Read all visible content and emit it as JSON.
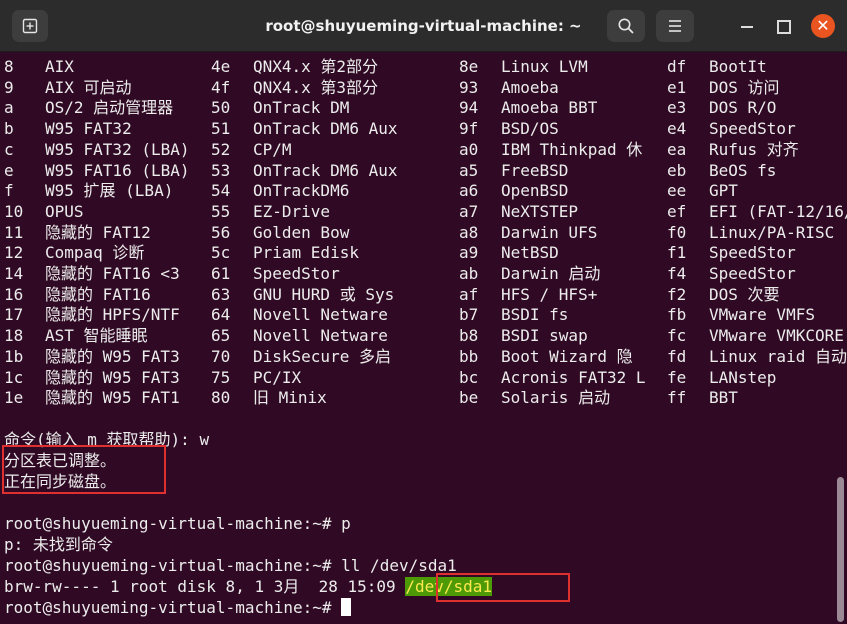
{
  "window": {
    "title": "root@shuyueming-virtual-machine: ~"
  },
  "icons": {
    "new_tab": "new-tab-icon",
    "search": "search-icon",
    "menu": "hamburger-menu-icon",
    "minimize": "minimize-icon",
    "maximize": "maximize-icon",
    "close": "close-icon",
    "close_glyph": "✕"
  },
  "colors": {
    "background": "#300a24",
    "close_button": "#e95420",
    "highlight_bg": "#4e9a06",
    "highlight_fg": "#fce94f",
    "annotation": "#e02f2f"
  },
  "partition_table": [
    [
      "8",
      "AIX",
      "4e",
      "QNX4.x 第2部分",
      "8e",
      "Linux LVM",
      "df",
      "BootIt"
    ],
    [
      "9",
      "AIX 可启动",
      "4f",
      "QNX4.x 第3部分",
      "93",
      "Amoeba",
      "e1",
      "DOS 访问"
    ],
    [
      "a",
      "OS/2 启动管理器",
      "50",
      "OnTrack DM",
      "94",
      "Amoeba BBT",
      "e3",
      "DOS R/O"
    ],
    [
      "b",
      "W95 FAT32",
      "51",
      "OnTrack DM6 Aux",
      "9f",
      "BSD/OS",
      "e4",
      "SpeedStor"
    ],
    [
      "c",
      "W95 FAT32 (LBA)",
      "52",
      "CP/M",
      "a0",
      "IBM Thinkpad 休",
      "ea",
      "Rufus 对齐"
    ],
    [
      "e",
      "W95 FAT16 (LBA)",
      "53",
      "OnTrack DM6 Aux",
      "a5",
      "FreeBSD",
      "eb",
      "BeOS fs"
    ],
    [
      "f",
      "W95 扩展 (LBA)",
      "54",
      "OnTrackDM6",
      "a6",
      "OpenBSD",
      "ee",
      "GPT"
    ],
    [
      "10",
      "OPUS",
      "55",
      "EZ-Drive",
      "a7",
      "NeXTSTEP",
      "ef",
      "EFI (FAT-12/16/"
    ],
    [
      "11",
      "隐藏的 FAT12",
      "56",
      "Golden Bow",
      "a8",
      "Darwin UFS",
      "f0",
      "Linux/PA-RISC"
    ],
    [
      "12",
      "Compaq 诊断",
      "5c",
      "Priam Edisk",
      "a9",
      "NetBSD",
      "f1",
      "SpeedStor"
    ],
    [
      "14",
      "隐藏的 FAT16 <3",
      "61",
      "SpeedStor",
      "ab",
      "Darwin 启动",
      "f4",
      "SpeedStor"
    ],
    [
      "16",
      "隐藏的 FAT16",
      "63",
      "GNU HURD 或 Sys",
      "af",
      "HFS / HFS+",
      "f2",
      "DOS 次要"
    ],
    [
      "17",
      "隐藏的 HPFS/NTF",
      "64",
      "Novell Netware",
      "b7",
      "BSDI fs",
      "fb",
      "VMware VMFS"
    ],
    [
      "18",
      "AST 智能睡眠",
      "65",
      "Novell Netware",
      "b8",
      "BSDI swap",
      "fc",
      "VMware VMKCORE"
    ],
    [
      "1b",
      "隐藏的 W95 FAT3",
      "70",
      "DiskSecure 多启",
      "bb",
      "Boot Wizard 隐",
      "fd",
      "Linux raid 自动"
    ],
    [
      "1c",
      "隐藏的 W95 FAT3",
      "75",
      "PC/IX",
      "bc",
      "Acronis FAT32 L",
      "fe",
      "LANstep"
    ],
    [
      "1e",
      "隐藏的 W95 FAT1",
      "80",
      "旧 Minix",
      "be",
      "Solaris 启动",
      "ff",
      "BBT"
    ]
  ],
  "session": {
    "command_prompt": "命令(输入 m 获取帮助): ",
    "command_input": "w",
    "msg_adjusted": "分区表已调整。",
    "msg_syncing": "正在同步磁盘。",
    "prompt1": "root@shuyueming-virtual-machine:~# ",
    "cmd1": "p",
    "not_found": "p: 未找到命令",
    "prompt2": "root@shuyueming-virtual-machine:~# ",
    "cmd2": "ll /dev/sda1",
    "ls_prefix": "brw-rw---- 1 root disk 8, 1 3月  28 15:09 ",
    "ls_device": "/dev/sda1",
    "prompt3": "root@shuyueming-virtual-machine:~# "
  }
}
